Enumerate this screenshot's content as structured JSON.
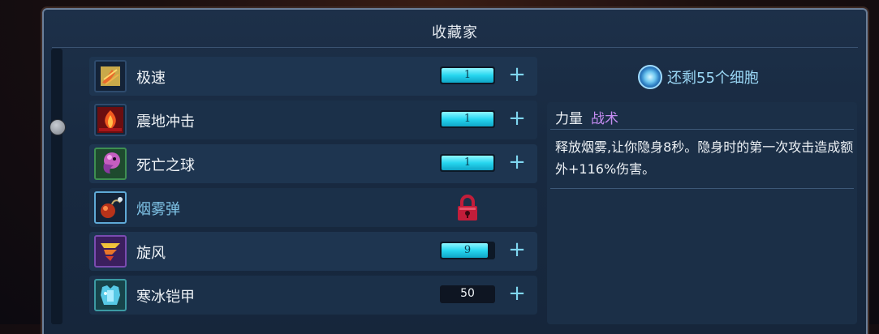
{
  "title": "收藏家",
  "cells": {
    "text": "还剩55个细胞",
    "icon": "cell-icon"
  },
  "items": [
    {
      "name": "极速",
      "level": "1",
      "fill": 1.0,
      "state": "bar",
      "icon": "speed-scroll-icon"
    },
    {
      "name": "震地冲击",
      "level": "1",
      "fill": 1.0,
      "state": "bar",
      "icon": "ground-slam-icon"
    },
    {
      "name": "死亡之球",
      "level": "1",
      "fill": 1.0,
      "state": "bar",
      "icon": "death-orb-icon"
    },
    {
      "name": "烟雾弹",
      "level": "",
      "fill": 0,
      "state": "locked",
      "icon": "smoke-bomb-icon"
    },
    {
      "name": "旋风",
      "level": "9",
      "fill": 0.9,
      "state": "bar",
      "icon": "tornado-icon"
    },
    {
      "name": "寒冰铠甲",
      "level": "50",
      "fill": 0,
      "state": "plain",
      "icon": "ice-armor-icon"
    }
  ],
  "detail": {
    "stat": "力量",
    "tag": "战术",
    "description": "释放烟雾,让你隐身8秒。隐身时的第一次攻击造成额外+116%伤害。"
  },
  "colors": {
    "accent": "#26d6ef",
    "tag": "#c58cf2",
    "lock": "#c21d3a"
  }
}
